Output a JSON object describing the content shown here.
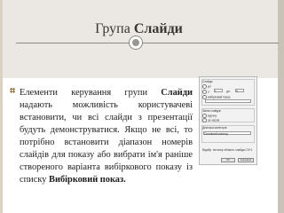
{
  "title": {
    "prefix": "Група ",
    "bold": "Слайди"
  },
  "body": {
    "part1": "Елементи керування групи ",
    "bold1": "Слайди",
    "part2": " надають можливість користувачеві встановити, чи всі слайди з презентації будуть демонструватися. Якщо не всі, то потрібно встановити діапазон номерів слайдів для показу або вибрати ім'я раніше створеного варіанта вибіркового показу із списку ",
    "bold2": "Вибірковий показ."
  },
  "colors": {
    "title_band": "#ebe7e2",
    "text": "#1e1e1e",
    "bullet": "#8a6a2a"
  },
  "dialog": {
    "group_label": "Слайди",
    "opt_all": "усі",
    "opt_from": "з:",
    "from_value": "1",
    "opt_to": "до:",
    "to_value": "9",
    "opt_custom": "вибірковий показ:",
    "display_label": "Зміна слайдів",
    "opt_manual": "вручну",
    "opt_timing": "за часом",
    "monitor_label": "Декілька моніторів",
    "monitor_value": "Основний монітор",
    "note": "Відобр. поточну область слайда СЧ+1",
    "ok": "OK",
    "cancel": "Скасувати"
  }
}
